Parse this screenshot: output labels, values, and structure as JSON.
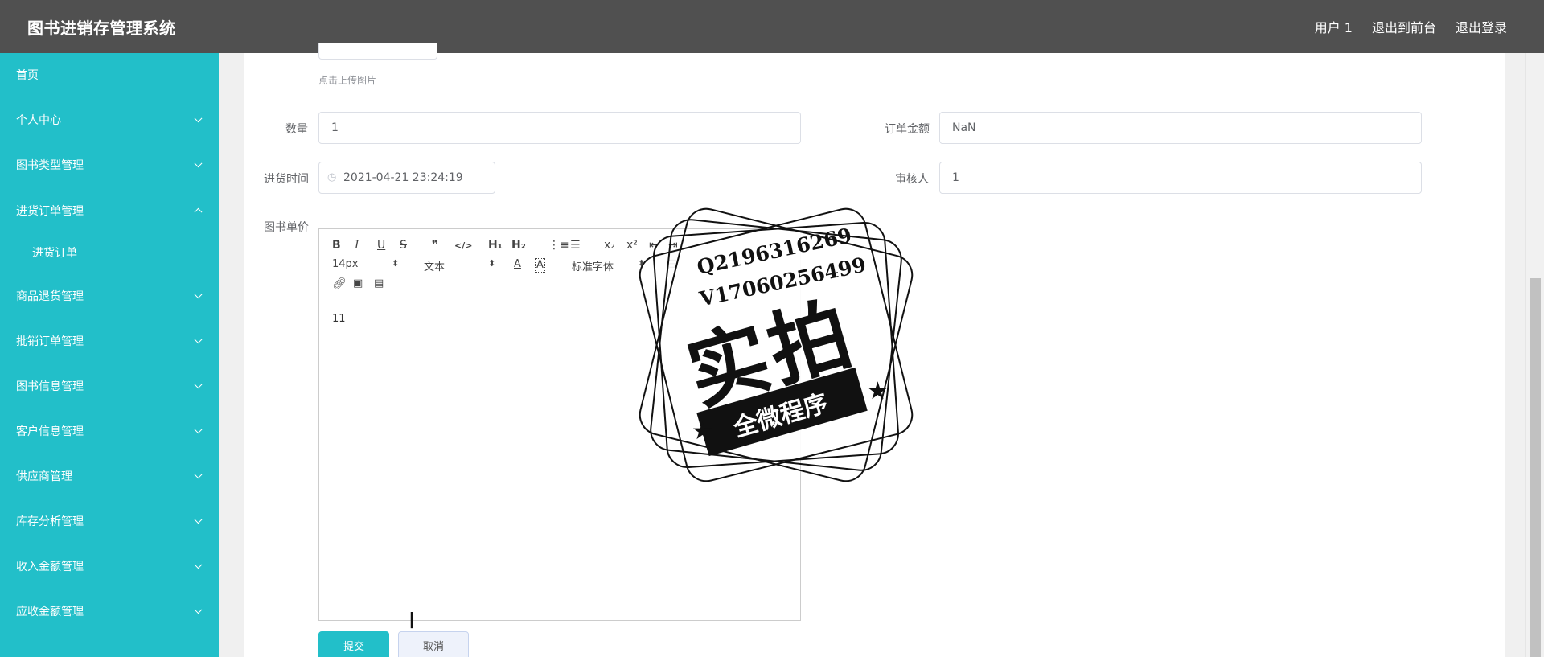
{
  "header": {
    "title": "图书进销存管理系统",
    "links": [
      "用户 1",
      "退出到前台",
      "退出登录"
    ]
  },
  "sidebar": {
    "items": [
      {
        "label": "首页"
      },
      {
        "label": "个人中心"
      },
      {
        "label": "图书类型管理"
      },
      {
        "label": "进货订单管理"
      },
      {
        "label": "进货订单"
      },
      {
        "label": "商品退货管理"
      },
      {
        "label": "批销订单管理"
      },
      {
        "label": "图书信息管理"
      },
      {
        "label": "客户信息管理"
      },
      {
        "label": "供应商管理"
      },
      {
        "label": "库存分析管理"
      },
      {
        "label": "收入金额管理"
      },
      {
        "label": "应收金额管理"
      }
    ]
  },
  "form": {
    "upload_hint": "点击上传图片",
    "quantity_label": "数量",
    "quantity_value": "1",
    "amount_label": "订单金额",
    "amount_value": "NaN",
    "time_label": "进货时间",
    "time_value": "2021-04-21 23:24:19",
    "reviewer_label": "审核人",
    "reviewer_value": "1",
    "price_label": "图书单价",
    "editor_content": "11",
    "submit_label": "提交",
    "cancel_label": "取消"
  },
  "editor_toolbar": {
    "row1": [
      "B",
      "I",
      "U",
      "S",
      "❞",
      "</>",
      "H₁",
      "H₂",
      "⋮≡",
      "☰",
      "x₂",
      "x²"
    ],
    "font_size": "14px",
    "paragraph": "文本",
    "font_family": "标准字体",
    "color_icon": "A",
    "bgcolor_icon": "A"
  },
  "watermark": {
    "line1": "Q2196316269",
    "line2": "V17060256499",
    "big": "实拍",
    "ribbon": "全微程序"
  }
}
